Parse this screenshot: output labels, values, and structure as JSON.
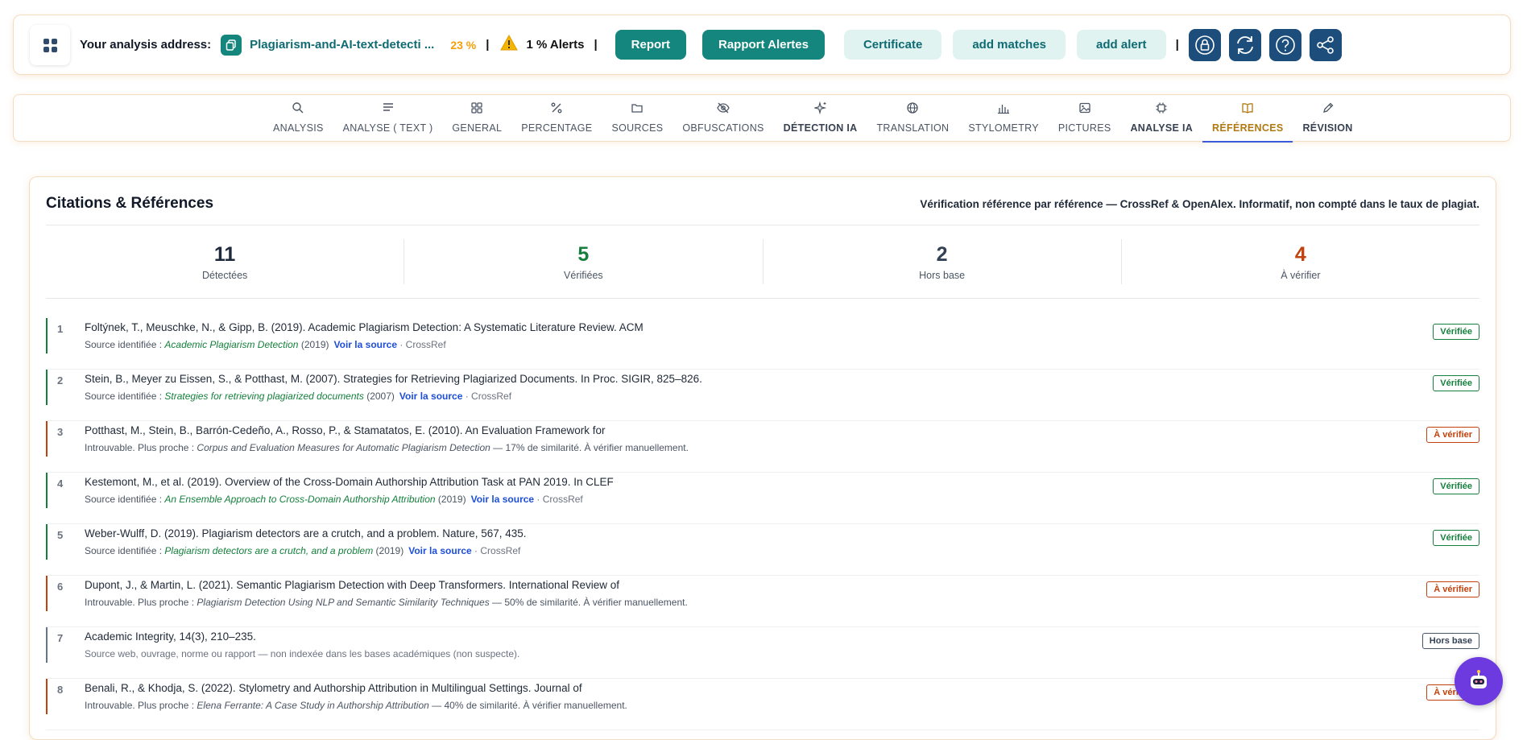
{
  "topbar": {
    "address_label": "Your analysis address:",
    "address_value": "Plagiarism-and-AI-text-detecti ...",
    "percent": "23 %",
    "separator": "|",
    "alerts": "1 % Alerts",
    "buttons": {
      "report": "Report",
      "rapport_alertes": "Rapport Alertes",
      "certificate": "Certificate",
      "add_matches": "add matches",
      "add_alert": "add alert"
    },
    "icon_buttons": [
      "lock-icon",
      "refresh-icon",
      "help-icon",
      "share-icon"
    ]
  },
  "tabs": [
    {
      "label": "ANALYSIS",
      "icon": "search-icon"
    },
    {
      "label": "ANALYSE ( TEXT )",
      "icon": "text-lines-icon"
    },
    {
      "label": "GENERAL",
      "icon": "grid-icon"
    },
    {
      "label": "PERCENTAGE",
      "icon": "percent-icon"
    },
    {
      "label": "SOURCES",
      "icon": "folder-icon"
    },
    {
      "label": "OBFUSCATIONS",
      "icon": "eye-off-icon"
    },
    {
      "label": "DÉTECTION IA",
      "icon": "sparkles-icon"
    },
    {
      "label": "TRANSLATION",
      "icon": "globe-icon"
    },
    {
      "label": "STYLOMETRY",
      "icon": "bar-chart-icon"
    },
    {
      "label": "PICTURES",
      "icon": "image-icon"
    },
    {
      "label": "ANALYSE IA",
      "icon": "chip-icon"
    },
    {
      "label": "RÉFÉRENCES",
      "icon": "book-icon"
    },
    {
      "label": "RÉVISION",
      "icon": "pencil-icon"
    }
  ],
  "active_tab": "RÉFÉRENCES",
  "colors": {
    "accent": "#14867d",
    "ok": "#15803d",
    "warn": "#c2410c",
    "navy": "#1d4e7b",
    "orange": "#f59e0b"
  },
  "card": {
    "title": "Citations & Références",
    "note": "Vérification référence par référence — CrossRef & OpenAlex. Informatif, non compté dans le taux de plagiat.",
    "stats": [
      {
        "value": "11",
        "label": "Détectées",
        "color": "#1e293b"
      },
      {
        "value": "5",
        "label": "Vérifiées",
        "color": "#15803d"
      },
      {
        "value": "2",
        "label": "Hors base",
        "color": "#334155"
      },
      {
        "value": "4",
        "label": "À vérifier",
        "color": "#c2410c"
      }
    ],
    "references": [
      {
        "n": "1",
        "text": "Foltýnek, T., Meuschke, N., & Gipp, B. (2019). Academic Plagiarism Detection: A Systematic Literature Review. ACM",
        "status": "ok",
        "badge": "Vérifiée",
        "prefix": "Source identifiée : ",
        "title": "Academic Plagiarism Detection",
        "year": " (2019)",
        "link": "Voir la source",
        "db": " · CrossRef"
      },
      {
        "n": "2",
        "text": "Stein, B., Meyer zu Eissen, S., & Potthast, M. (2007). Strategies for Retrieving Plagiarized Documents. In Proc. SIGIR, 825–826.",
        "status": "ok",
        "badge": "Vérifiée",
        "prefix": "Source identifiée : ",
        "title": "Strategies for retrieving plagiarized documents",
        "year": " (2007)",
        "link": "Voir la source",
        "db": " · CrossRef"
      },
      {
        "n": "3",
        "text": "Potthast, M., Stein, B., Barrón-Cedeño, A., Rosso, P., & Stamatatos, E. (2010). An Evaluation Framework for",
        "status": "bad",
        "badge": "À vérifier",
        "prefix": "Introuvable. Plus proche : ",
        "title": "Corpus and Evaluation Measures for Automatic Plagiarism Detection",
        "suffix": " — 17% de similarité. À vérifier manuellement."
      },
      {
        "n": "4",
        "text": "Kestemont, M., et al. (2019). Overview of the Cross-Domain Authorship Attribution Task at PAN 2019. In CLEF",
        "status": "ok",
        "badge": "Vérifiée",
        "prefix": "Source identifiée : ",
        "title": "An Ensemble Approach to Cross-Domain Authorship Attribution",
        "year": " (2019)",
        "link": "Voir la source",
        "db": " · CrossRef"
      },
      {
        "n": "5",
        "text": "Weber-Wulff, D. (2019). Plagiarism detectors are a crutch, and a problem. Nature, 567, 435.",
        "status": "ok",
        "badge": "Vérifiée",
        "prefix": "Source identifiée : ",
        "title": "Plagiarism detectors are a crutch, and a problem",
        "year": " (2019)",
        "link": "Voir la source",
        "db": " · CrossRef"
      },
      {
        "n": "6",
        "text": "Dupont, J., & Martin, L. (2021). Semantic Plagiarism Detection with Deep Transformers. International Review of",
        "status": "bad",
        "badge": "À vérifier",
        "prefix": "Introuvable. Plus proche : ",
        "title": "Plagiarism Detection Using NLP and Semantic Similarity Techniques",
        "suffix": " — 50% de similarité. À vérifier manuellement."
      },
      {
        "n": "7",
        "text": "Academic Integrity, 14(3), 210–235.",
        "status": "base",
        "badge": "Hors base",
        "plain": "Source web, ouvrage, norme ou rapport — non indexée dans les bases académiques (non suspecte)."
      },
      {
        "n": "8",
        "text": "Benali, R., & Khodja, S. (2022). Stylometry and Authorship Attribution in Multilingual Settings. Journal of",
        "status": "bad",
        "badge": "À vérifier",
        "prefix": "Introuvable. Plus proche : ",
        "title": "Elena Ferrante: A Case Study in Authorship Attribution",
        "suffix": " — 40% de similarité. À vérifier manuellement."
      }
    ]
  }
}
